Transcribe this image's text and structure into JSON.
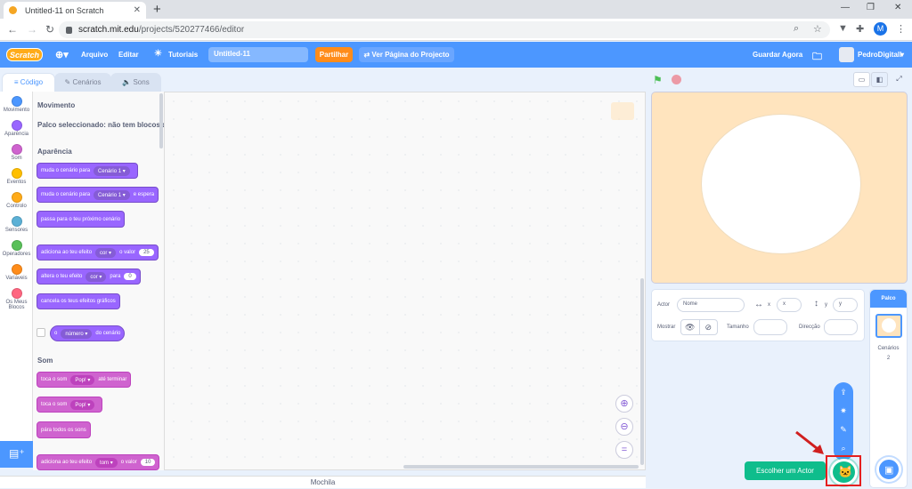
{
  "browser": {
    "tab_title": "Untitled-11 on Scratch",
    "url_host": "scratch.mit.edu",
    "url_path": "/projects/520277466/editor",
    "profile_initial": "M"
  },
  "menu": {
    "logo": "Scratch",
    "file": "Arquivo",
    "edit": "Editar",
    "tutorials": "Tutoriais",
    "project_title": "Untitled-11",
    "share": "Partilhar",
    "project_page": "Ver Página do Projecto",
    "save_now": "Guardar Agora",
    "username": "PedroDigitall"
  },
  "tabs": {
    "code": "Código",
    "costumes": "Cenários",
    "sounds": "Sons"
  },
  "categories": [
    {
      "label": "Movimento",
      "color": "#4c97ff"
    },
    {
      "label": "Aparência",
      "color": "#9966ff"
    },
    {
      "label": "Som",
      "color": "#cf63cf"
    },
    {
      "label": "Eventos",
      "color": "#ffbf00"
    },
    {
      "label": "Controlo",
      "color": "#ffab19"
    },
    {
      "label": "Sensores",
      "color": "#5cb1d6"
    },
    {
      "label": "Operadores",
      "color": "#59c059"
    },
    {
      "label": "Variáveis",
      "color": "#ff8c1a"
    },
    {
      "label": "Os Meus Blocos",
      "color": "#ff6680"
    }
  ],
  "palette": {
    "motion_heading": "Movimento",
    "motion_note": "Palco seleccionado: não tem blocos de movimento",
    "looks_heading": "Aparência",
    "sound_heading": "Som",
    "blocks": {
      "switch_backdrop": "muda o cenário para",
      "backdrop1": "Cenário 1",
      "switch_wait_pre": "muda o cenário para",
      "switch_wait_post": "e espera",
      "next_backdrop": "passa para o teu próximo cenário",
      "change_effect_pre": "adiciona ao teu efeito",
      "effect_color": "cor",
      "change_effect_mid": "o valor",
      "change_effect_val": "25",
      "set_effect_pre": "altera o teu efeito",
      "set_effect_mid": "para",
      "set_effect_val": "0",
      "clear_effects": "cancela os teus efeitos gráficos",
      "backdrop_of": "o",
      "number": "número",
      "backdrop_of_post": "do cenário",
      "play_until_pre": "toca o som",
      "sound_pop": "Pop!",
      "play_until_post": "até terminar",
      "start_sound": "toca o som",
      "stop_all": "pára todos os sons",
      "change_sfx_pre": "adiciona ao teu efeito",
      "sfx_pitch": "tom",
      "change_sfx_mid": "o valor",
      "change_sfx_val": "10"
    }
  },
  "backpack": "Mochila",
  "sprite_info": {
    "sprite_label": "Actor",
    "name_placeholder": "Nome",
    "x_label": "x",
    "x_placeholder": "x",
    "y_label": "y",
    "y_placeholder": "y",
    "show_label": "Mostrar",
    "size_label": "Tamanho",
    "direction_label": "Direcção"
  },
  "stage_pane": {
    "title": "Palco",
    "backdrops_label": "Cenários",
    "backdrops_count": "2"
  },
  "choose_sprite": "Escolher um Actor"
}
